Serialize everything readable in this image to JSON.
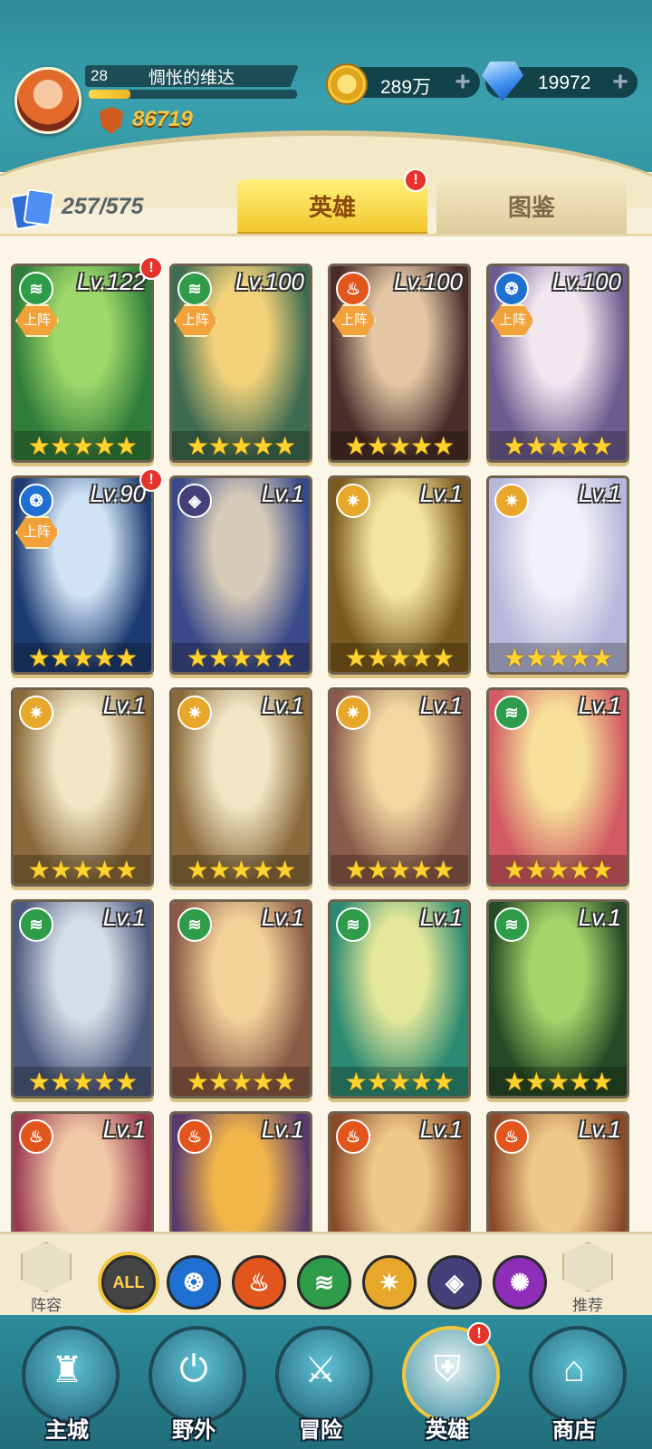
{
  "header": {
    "player_level": "28",
    "player_name": "惆怅的维达",
    "xp_fraction": 0.2,
    "power": "86719",
    "gold": "289万",
    "gems": "19972",
    "plus_symbol": "+"
  },
  "tabs": {
    "hero_count": "257/575",
    "heroes": "英雄",
    "atlas": "图鉴",
    "heroes_badge": "!"
  },
  "heroes": [
    {
      "level": "Lv.122",
      "element": "nature",
      "deployed": true,
      "badge": "!",
      "stars": 5,
      "colors": [
        "#2f7d3a",
        "#9fd86a"
      ]
    },
    {
      "level": "Lv.100",
      "element": "nature",
      "deployed": true,
      "stars": 5,
      "colors": [
        "#3f6b52",
        "#f3d27a"
      ]
    },
    {
      "level": "Lv.100",
      "element": "fire",
      "deployed": true,
      "stars": 5,
      "colors": [
        "#4a2d2a",
        "#e4c8a6"
      ]
    },
    {
      "level": "Lv.100",
      "element": "water",
      "deployed": true,
      "stars": 5,
      "colors": [
        "#6c5d8f",
        "#f2e6ef"
      ]
    },
    {
      "level": "Lv.90",
      "element": "water",
      "deployed": true,
      "badge": "!",
      "stars": 5,
      "colors": [
        "#1d3b72",
        "#cfe3f4"
      ]
    },
    {
      "level": "Lv.1",
      "element": "dark",
      "stars": 5,
      "colors": [
        "#3b4a8a",
        "#d7ccb8"
      ]
    },
    {
      "level": "Lv.1",
      "element": "light",
      "stars": 5,
      "colors": [
        "#7a5a1e",
        "#f4e4a1"
      ]
    },
    {
      "level": "Lv.1",
      "element": "light",
      "stars": 5,
      "colors": [
        "#b6b7da",
        "#f2f0f8"
      ]
    },
    {
      "level": "Lv.1",
      "element": "light",
      "stars": 5,
      "colors": [
        "#8a6a3a",
        "#f2e6c6"
      ]
    },
    {
      "level": "Lv.1",
      "element": "light",
      "stars": 5,
      "colors": [
        "#8a6a3a",
        "#f2e6c6"
      ]
    },
    {
      "level": "Lv.1",
      "element": "light",
      "stars": 5,
      "colors": [
        "#8a5a4a",
        "#f1d8a1"
      ]
    },
    {
      "level": "Lv.1",
      "element": "nature",
      "stars": 5,
      "colors": [
        "#d25a62",
        "#f6e09a"
      ]
    },
    {
      "level": "Lv.1",
      "element": "nature",
      "stars": 5,
      "colors": [
        "#4c5a7e",
        "#d7dde8"
      ]
    },
    {
      "level": "Lv.1",
      "element": "nature",
      "stars": 5,
      "colors": [
        "#8a5a46",
        "#f3d29a"
      ]
    },
    {
      "level": "Lv.1",
      "element": "nature",
      "stars": 5,
      "colors": [
        "#2c8a72",
        "#e5e89a"
      ]
    },
    {
      "level": "Lv.1",
      "element": "nature",
      "stars": 5,
      "colors": [
        "#264a26",
        "#a5d46a"
      ]
    },
    {
      "level": "Lv.1",
      "element": "fire",
      "stars": 0,
      "colors": [
        "#9a3a52",
        "#f2c9a6"
      ]
    },
    {
      "level": "Lv.1",
      "element": "fire",
      "stars": 0,
      "colors": [
        "#5a3a6e",
        "#f2b54a"
      ]
    },
    {
      "level": "Lv.1",
      "element": "fire",
      "stars": 0,
      "colors": [
        "#8a4a2a",
        "#f0c88a"
      ]
    },
    {
      "level": "Lv.1",
      "element": "fire",
      "stars": 0,
      "colors": [
        "#8a4a2a",
        "#f0c88a"
      ]
    }
  ],
  "deploy_label": "上阵",
  "filter_bar": {
    "lineup": "阵容",
    "recommend": "推荐",
    "all": "ALL"
  },
  "nav": [
    {
      "label": "主城",
      "glyph": "♜"
    },
    {
      "label": "野外",
      "glyph": "⏻"
    },
    {
      "label": "冒险",
      "glyph": "⚔"
    },
    {
      "label": "英雄",
      "glyph": "⛨",
      "active": true,
      "badge": "!"
    },
    {
      "label": "商店",
      "glyph": "⌂"
    }
  ],
  "colors": {
    "nature": "#2e9c48",
    "fire": "#e2551d",
    "water": "#1f70d1",
    "dark": "#44407a",
    "light": "#e7a72a",
    "accent_gold": "#f2c53d"
  }
}
